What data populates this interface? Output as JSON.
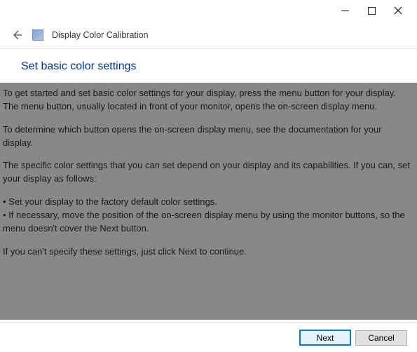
{
  "window": {
    "app_title": "Display Color Calibration"
  },
  "page": {
    "heading": "Set basic color settings",
    "p1": "To get started and set basic color settings for your display, press the menu button for your display. The menu button, usually located in front of your monitor, opens the on-screen display menu.",
    "p2": "To determine which button opens the on-screen display menu, see the documentation for your display.",
    "p3": "The specific color settings that you can set depend on your display and its capabilities. If you can, set your display as follows:",
    "b1": "• Set your display to the factory default color settings.",
    "b2": "• If necessary, move the position of the on-screen display menu by using the monitor buttons, so the menu doesn't cover the Next button.",
    "p4": "If you can't specify these settings,  just click Next to continue."
  },
  "footer": {
    "next_label": "Next",
    "cancel_label": "Cancel"
  }
}
